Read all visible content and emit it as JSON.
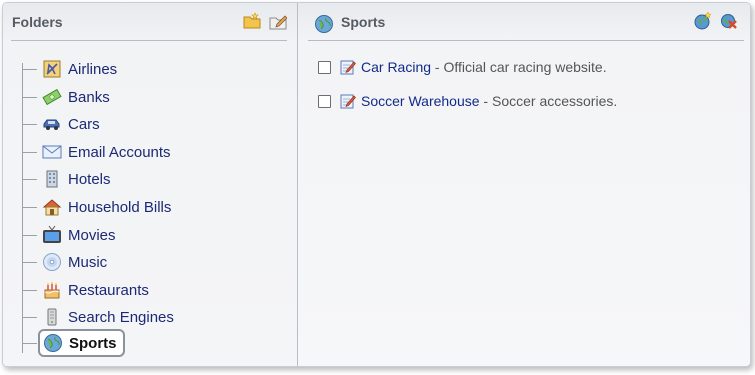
{
  "folders_panel": {
    "title": "Folders",
    "icons": [
      "new-folder-icon",
      "edit-folder-icon"
    ],
    "items": [
      {
        "label": "Airlines",
        "icon": "airplane-icon"
      },
      {
        "label": "Banks",
        "icon": "money-icon"
      },
      {
        "label": "Cars",
        "icon": "car-icon"
      },
      {
        "label": "Email Accounts",
        "icon": "envelope-icon"
      },
      {
        "label": "Hotels",
        "icon": "building-icon"
      },
      {
        "label": "Household Bills",
        "icon": "house-icon"
      },
      {
        "label": "Movies",
        "icon": "tv-icon"
      },
      {
        "label": "Music",
        "icon": "cd-icon"
      },
      {
        "label": "Restaurants",
        "icon": "cake-icon"
      },
      {
        "label": "Search Engines",
        "icon": "server-icon"
      },
      {
        "label": "Sports",
        "icon": "globe-icon",
        "selected": true
      }
    ]
  },
  "content_panel": {
    "title": "Sports",
    "title_icon": "globe-icon",
    "icons": [
      "add-bookmark-icon",
      "remove-icon"
    ],
    "bookmarks": [
      {
        "name": "Car Racing",
        "description": " - Official car racing website.",
        "checked": false
      },
      {
        "name": "Soccer Warehouse",
        "description": " - Soccer accessories.",
        "checked": false
      }
    ]
  },
  "colors": {
    "link": "#122a8a",
    "tree_label": "#1c2a74",
    "header_text": "#555b63"
  }
}
